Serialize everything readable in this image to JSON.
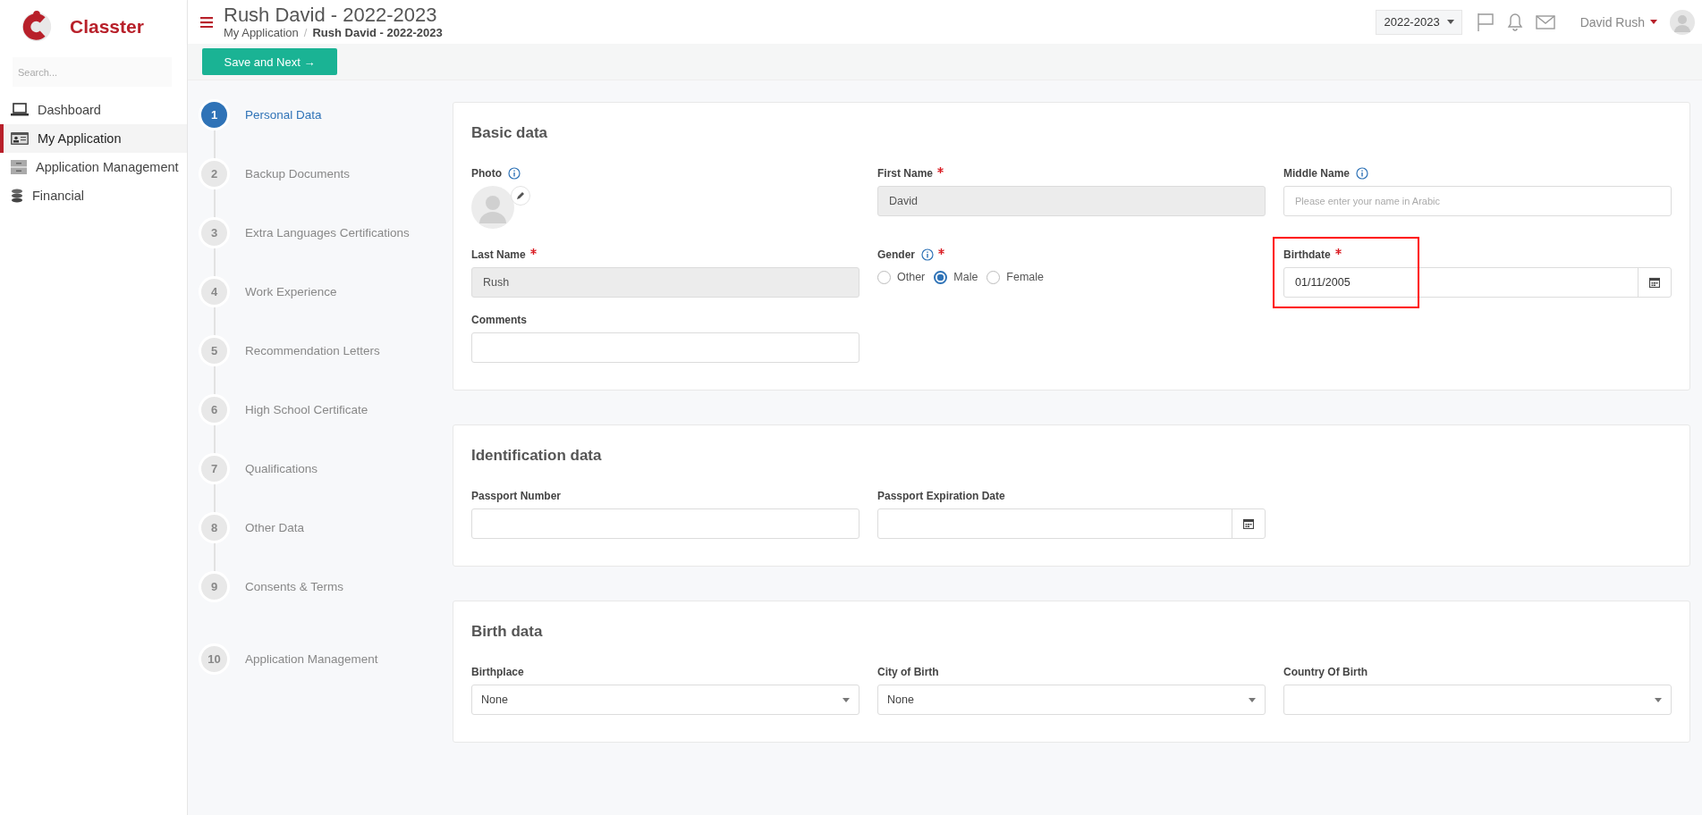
{
  "brand": {
    "name": "Classter"
  },
  "sidebar": {
    "search": {
      "placeholder": "Search..."
    },
    "items": [
      {
        "label": "Dashboard",
        "selected": false
      },
      {
        "label": "My Application",
        "selected": true
      },
      {
        "label": "Application Management",
        "selected": false
      },
      {
        "label": "Financial",
        "selected": false
      }
    ]
  },
  "header": {
    "title": "Rush David - 2022-2023",
    "breadcrumb": {
      "parent": "My Application",
      "separator": "/",
      "current": "Rush David - 2022-2023"
    },
    "year": "2022-2023",
    "user": "David Rush"
  },
  "toolbar": {
    "primary_button": "Save and Next →"
  },
  "steps": [
    {
      "number": "1",
      "label": "Personal Data",
      "selected": true,
      "separated": false
    },
    {
      "number": "2",
      "label": "Backup Documents",
      "selected": false,
      "separated": false
    },
    {
      "number": "3",
      "label": "Extra Languages Certifications",
      "selected": false,
      "separated": false
    },
    {
      "number": "4",
      "label": "Work Experience",
      "selected": false,
      "separated": false
    },
    {
      "number": "5",
      "label": "Recommendation Letters",
      "selected": false,
      "separated": false
    },
    {
      "number": "6",
      "label": "High School Certificate",
      "selected": false,
      "separated": false
    },
    {
      "number": "7",
      "label": "Qualifications",
      "selected": false,
      "separated": false
    },
    {
      "number": "8",
      "label": "Other Data",
      "selected": false,
      "separated": false
    },
    {
      "number": "9",
      "label": "Consents & Terms",
      "selected": false,
      "separated": false
    },
    {
      "number": "10",
      "label": "Application Management",
      "selected": false,
      "separated": true
    }
  ],
  "sections": [
    {
      "title": "Basic data",
      "fields": [
        {
          "kind": "photo",
          "label": "Photo",
          "required": false,
          "info": true
        },
        {
          "kind": "text",
          "label": "First Name",
          "required": true,
          "info": false,
          "value": "David",
          "disabled": true
        },
        {
          "kind": "text",
          "label": "Middle Name",
          "required": false,
          "info": true,
          "placeholder": "Please enter your name in Arabic",
          "disabled": false
        },
        {
          "kind": "text",
          "label": "Last Name",
          "required": true,
          "info": false,
          "value": "Rush",
          "disabled": true
        },
        {
          "kind": "radio",
          "label": "Gender",
          "required": true,
          "info": true,
          "options": [
            {
              "label": "Other",
              "selected": false
            },
            {
              "label": "Male",
              "selected": true
            },
            {
              "label": "Female",
              "selected": false
            }
          ]
        },
        {
          "kind": "date",
          "label": "Birthdate",
          "required": true,
          "info": false,
          "value": "01/11/2005",
          "highlighted": true
        },
        {
          "kind": "text",
          "label": "Comments",
          "required": false,
          "info": false,
          "disabled": false
        }
      ]
    },
    {
      "title": "Identification data",
      "fields": [
        {
          "kind": "text",
          "label": "Passport Number",
          "required": false,
          "info": false,
          "disabled": false
        },
        {
          "kind": "date",
          "label": "Passport Expiration Date",
          "required": false,
          "info": false,
          "highlighted": false
        }
      ]
    },
    {
      "title": "Birth data",
      "fields": [
        {
          "kind": "select",
          "label": "Birthplace",
          "required": false,
          "info": false,
          "value": "None"
        },
        {
          "kind": "select",
          "label": "City of Birth",
          "required": false,
          "info": false,
          "value": "None"
        },
        {
          "kind": "select",
          "label": "Country Of Birth",
          "required": false,
          "info": false
        }
      ]
    }
  ]
}
